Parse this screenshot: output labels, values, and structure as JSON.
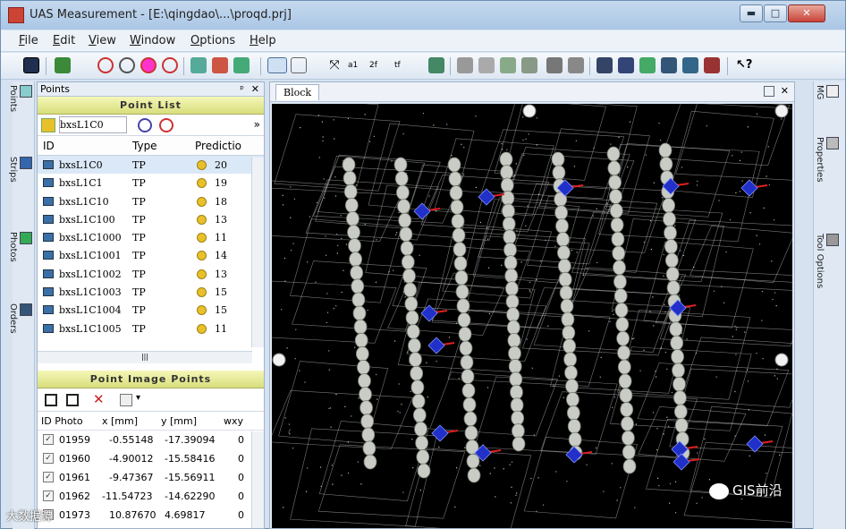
{
  "window": {
    "title": "UAS Measurement - [E:\\qingdao\\...\\proqd.prj]",
    "min_glyph": "▬",
    "max_glyph": "□",
    "close_glyph": "✕"
  },
  "menubar": {
    "items": [
      {
        "key": "F",
        "rest": "ile"
      },
      {
        "key": "E",
        "rest": "dit"
      },
      {
        "key": "V",
        "rest": "iew"
      },
      {
        "key": "W",
        "rest": "indow"
      },
      {
        "key": "O",
        "rest": "ptions"
      },
      {
        "key": "H",
        "rest": "elp"
      }
    ]
  },
  "toolbar": {
    "t1": "a1",
    "t2": "2f",
    "t3": "tf",
    "help_glyph": "↖?"
  },
  "left_tabs": [
    "Points",
    "Strips",
    "Photos",
    "Orders"
  ],
  "points_panel": {
    "title": "Points",
    "pin_glyph": "ᵖ",
    "close_glyph": "✕",
    "list_header": "Point List",
    "search_value": "bxsL1C0",
    "more_glyph": "»",
    "columns": [
      "ID",
      "Type",
      "Predictio"
    ],
    "rows": [
      {
        "id": "bxsL1C0",
        "type": "TP",
        "pred": "20"
      },
      {
        "id": "bxsL1C1",
        "type": "TP",
        "pred": "19"
      },
      {
        "id": "bxsL1C10",
        "type": "TP",
        "pred": "18"
      },
      {
        "id": "bxsL1C100",
        "type": "TP",
        "pred": "13"
      },
      {
        "id": "bxsL1C1000",
        "type": "TP",
        "pred": "11"
      },
      {
        "id": "bxsL1C1001",
        "type": "TP",
        "pred": "14"
      },
      {
        "id": "bxsL1C1002",
        "type": "TP",
        "pred": "13"
      },
      {
        "id": "bxsL1C1003",
        "type": "TP",
        "pred": "15"
      },
      {
        "id": "bxsL1C1004",
        "type": "TP",
        "pred": "15"
      },
      {
        "id": "bxsL1C1005",
        "type": "TP",
        "pred": "11"
      }
    ],
    "hscroll_label": "|||",
    "image_header": "Point Image Points",
    "image_columns": [
      "ID Photo",
      "x [mm]",
      "y [mm]",
      "wxy"
    ],
    "image_rows": [
      {
        "id": "01959",
        "x": "-0.55148",
        "y": "-17.39094",
        "w": "0"
      },
      {
        "id": "01960",
        "x": "-4.90012",
        "y": "-15.58416",
        "w": "0"
      },
      {
        "id": "01961",
        "x": "-9.47367",
        "y": "-15.56911",
        "w": "0"
      },
      {
        "id": "01962",
        "x": "-11.54723",
        "y": "-14.62290",
        "w": "0"
      },
      {
        "id": "01973",
        "x": "10.87670",
        "y": "4.69817",
        "w": "0"
      }
    ]
  },
  "block_panel": {
    "tab_label": "Block"
  },
  "right_tabs": [
    "MG",
    "Properties",
    "Tool Options"
  ],
  "watermarks": {
    "left": "大数据谭",
    "right": "GIS前沿"
  },
  "colors": {
    "accent": "#3b6fa7",
    "header_yellow": "#d8de7c",
    "viewport_bg": "#000000",
    "tie_point": "#c8ccc4",
    "control_point": "#2030c8",
    "vector_red": "#e02020",
    "footprint": "#d9d9d9"
  }
}
